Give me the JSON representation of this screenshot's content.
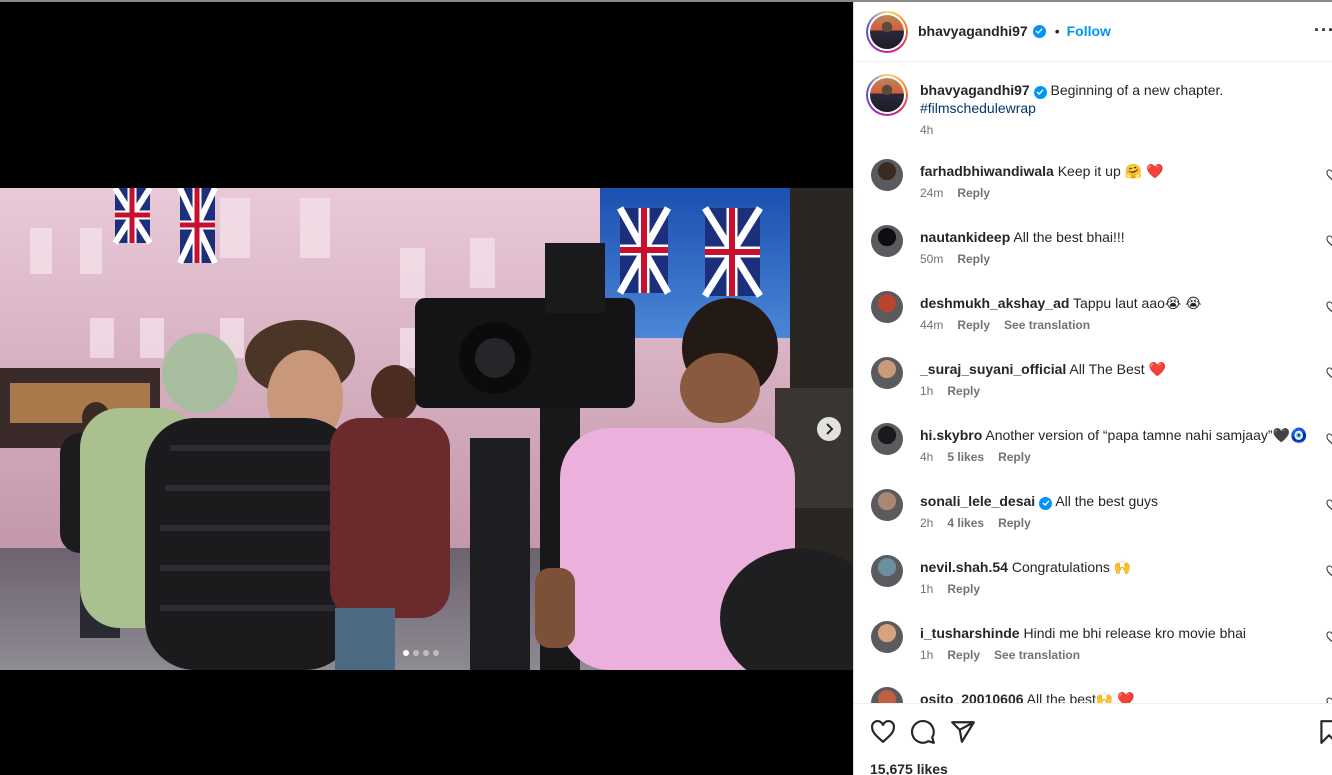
{
  "post": {
    "username": "bhavyagandhi97",
    "follow_label": "Follow",
    "separator": "•",
    "caption_text": "Beginning of a new chapter.",
    "caption_hashtag": "#filmschedulewrap",
    "caption_time": "4h",
    "likes": "15,675 likes",
    "carousel": {
      "count": 4,
      "active_index": 0
    }
  },
  "comments": [
    {
      "user": "farhadbhiwandiwala",
      "text": "Keep it up 🤗 ❤️",
      "time": "24m",
      "likes": "",
      "reply": "Reply",
      "translate": ""
    },
    {
      "user": "nautankideep",
      "text": "All the best bhai!!!",
      "time": "50m",
      "likes": "",
      "reply": "Reply",
      "translate": ""
    },
    {
      "user": "deshmukh_akshay_ad",
      "text": "Tappu laut aao😭 😭",
      "time": "44m",
      "likes": "",
      "reply": "Reply",
      "translate": "See translation"
    },
    {
      "user": "_suraj_suyani_official",
      "text": "All The Best ❤️",
      "time": "1h",
      "likes": "",
      "reply": "Reply",
      "translate": ""
    },
    {
      "user": "hi.skybro",
      "text": "Another version of “papa tamne nahi samjaay”🖤🧿",
      "time": "4h",
      "likes": "5 likes",
      "reply": "Reply",
      "translate": ""
    },
    {
      "user": "sonali_lele_desai",
      "text": "All the best guys",
      "time": "2h",
      "likes": "4 likes",
      "reply": "Reply",
      "translate": "",
      "verified": true
    },
    {
      "user": "nevil.shah.54",
      "text": "Congratulations 🙌",
      "time": "1h",
      "likes": "",
      "reply": "Reply",
      "translate": ""
    },
    {
      "user": "i_tusharshinde",
      "text": "Hindi me bhi release kro movie bhai",
      "time": "1h",
      "likes": "",
      "reply": "Reply",
      "translate": "See translation"
    },
    {
      "user": "osito_20010606",
      "text": "All the best🙌 ❤️",
      "time": "",
      "likes": "",
      "reply": "",
      "translate": ""
    }
  ],
  "icons": {
    "like": "heart-icon",
    "comment": "comment-icon",
    "share": "share-icon",
    "save": "bookmark-icon",
    "next": "chevron-right-icon",
    "more": "more-options-icon",
    "verified": "verified-badge-icon"
  },
  "colors": {
    "accent": "#0095f6",
    "text": "#262626",
    "muted": "#737373",
    "hashtag": "#00376b"
  }
}
